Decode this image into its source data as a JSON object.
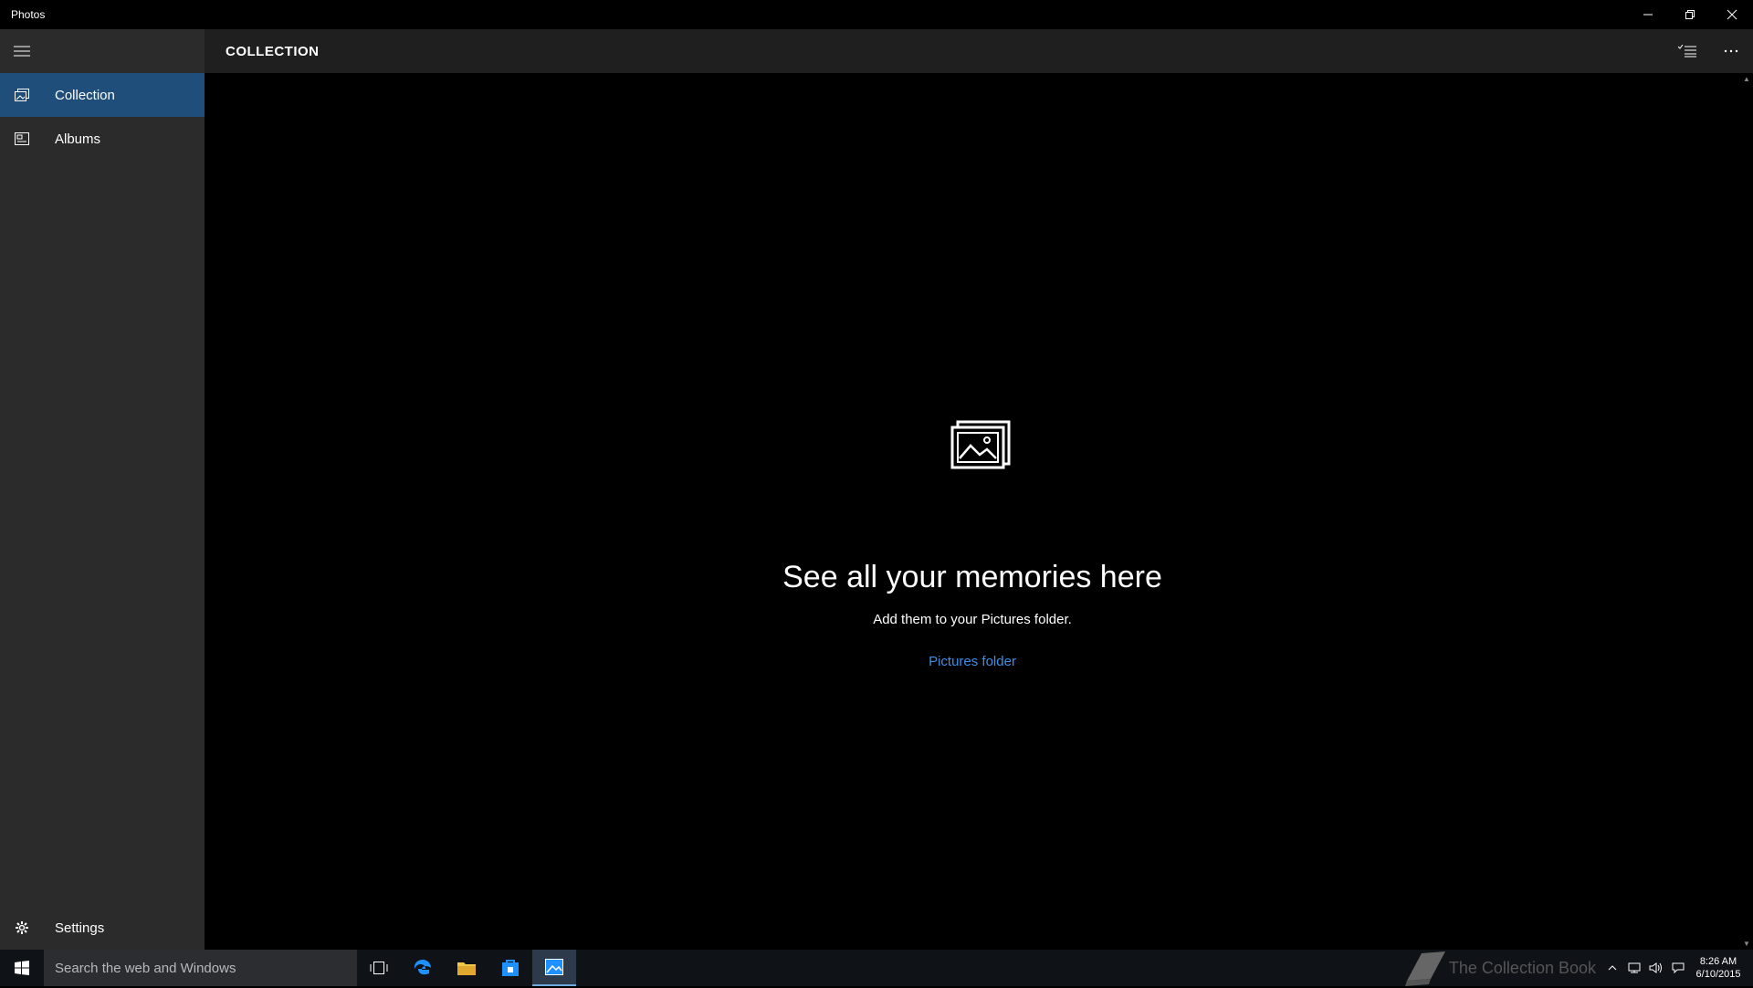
{
  "window": {
    "title": "Photos"
  },
  "sidebar": {
    "items": [
      {
        "label": "Collection",
        "icon": "collection-icon",
        "active": true
      },
      {
        "label": "Albums",
        "icon": "album-icon",
        "active": false
      }
    ],
    "settings_label": "Settings"
  },
  "header": {
    "title": "COLLECTION"
  },
  "empty_state": {
    "headline": "See all your memories here",
    "subline": "Add them to your Pictures folder.",
    "link": "Pictures folder"
  },
  "taskbar": {
    "search_placeholder": "Search the web and Windows",
    "watermark": "The Collection Book",
    "time": "8:26 AM",
    "date": "6/10/2015"
  },
  "colors": {
    "accent": "#1e4e79",
    "link": "#3d8ee8",
    "sidebar_bg": "#2b2b2b",
    "header_bg": "#1f1f1f"
  }
}
